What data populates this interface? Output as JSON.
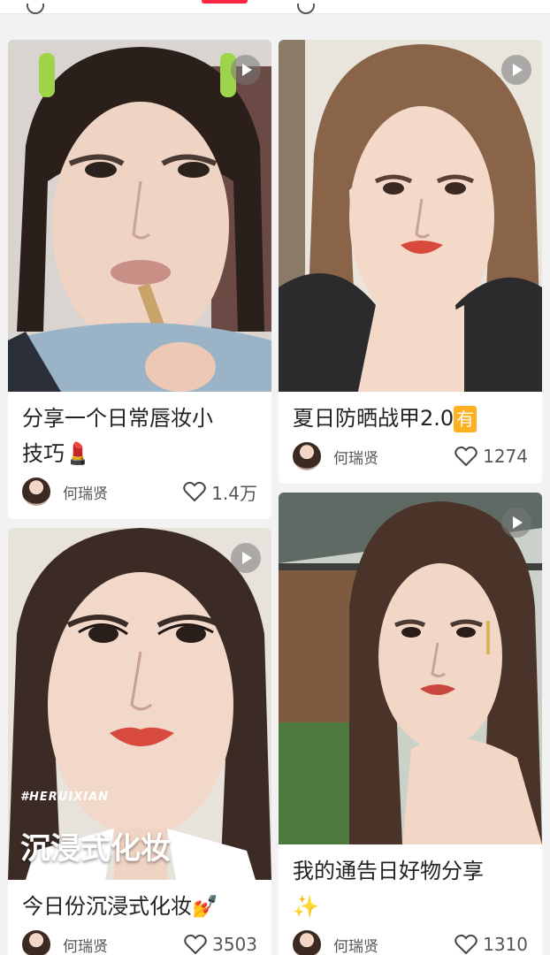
{
  "feed": {
    "cards": [
      {
        "title_line1": "分享一个日常唇妆小",
        "title_line2": "技巧💄",
        "author": "何瑞贤",
        "likes": "1.4万",
        "has_video": true
      },
      {
        "title_line1": "夏日防晒战甲2.0",
        "title_badge": "有",
        "author": "何瑞贤",
        "likes": "1274",
        "has_video": true
      },
      {
        "title_line1": "今日份沉浸式化妆💅",
        "author": "何瑞贤",
        "likes": "3503",
        "overlay_tag": "#HERUIXIAN",
        "overlay_banner": "沉浸式化妆",
        "has_video": true
      },
      {
        "title_line1": "我的通告日好物分享",
        "title_line2": "✨",
        "author": "何瑞贤",
        "likes": "1310",
        "has_video": true
      }
    ]
  },
  "colors": {
    "accent": "#ff2442",
    "badge": "#ffb020"
  },
  "icons": {
    "like": "heart-outline-icon",
    "play": "play-icon"
  }
}
